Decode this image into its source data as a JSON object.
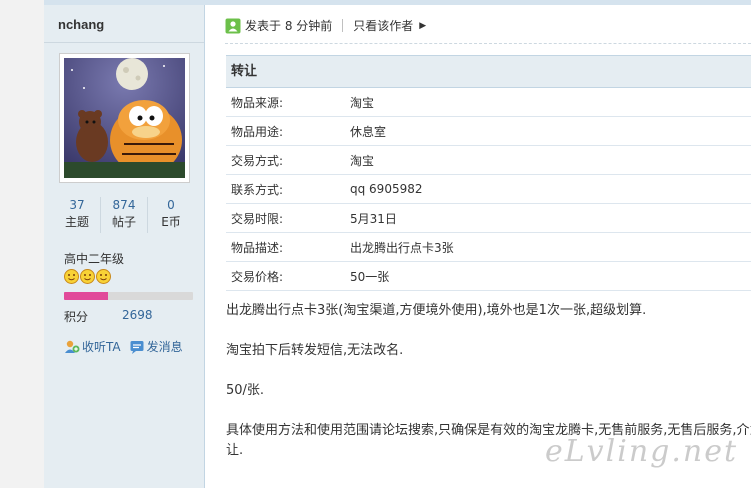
{
  "user": {
    "name": "nchang",
    "stats": [
      {
        "value": "37",
        "label": "主题"
      },
      {
        "value": "874",
        "label": "帖子"
      },
      {
        "value": "0",
        "label": "E币"
      }
    ],
    "level": "高中二年级",
    "credit_progress": 0.34,
    "score_label": "积分",
    "score_value": "2698",
    "follow_label": "收听TA",
    "message_label": "发消息"
  },
  "post": {
    "posted_time": "发表于 8 分钟前",
    "author_only": "只看该作者"
  },
  "trade": {
    "title": "转让",
    "rows": [
      {
        "key": "物品来源:",
        "value": "淘宝"
      },
      {
        "key": "物品用途:",
        "value": "休息室"
      },
      {
        "key": "交易方式:",
        "value": "淘宝"
      },
      {
        "key": "联系方式:",
        "value": "qq 6905982"
      },
      {
        "key": "交易时限:",
        "value": "5月31日"
      },
      {
        "key": "物品描述:",
        "value": "出龙腾出行点卡3张"
      },
      {
        "key": "交易价格:",
        "value": "50一张"
      }
    ]
  },
  "body": {
    "p1": "出龙腾出行点卡3张(淘宝渠道,方便境外使用),境外也是1次一张,超级划算.",
    "p2": "淘宝拍下后转发短信,无法改名.",
    "p3": "50/张.",
    "p4": "具体使用方法和使用范围请论坛搜索,只确保是有效的淘宝龙腾卡,无售前服务,无售后服务,介意者请绕道,不议价,",
    "p4_end": "让."
  },
  "watermark": "eLvling.net",
  "colors": {
    "link": "#336699",
    "sidebar_bg": "#e5edf2",
    "credit_fill": "#e14a9a"
  }
}
